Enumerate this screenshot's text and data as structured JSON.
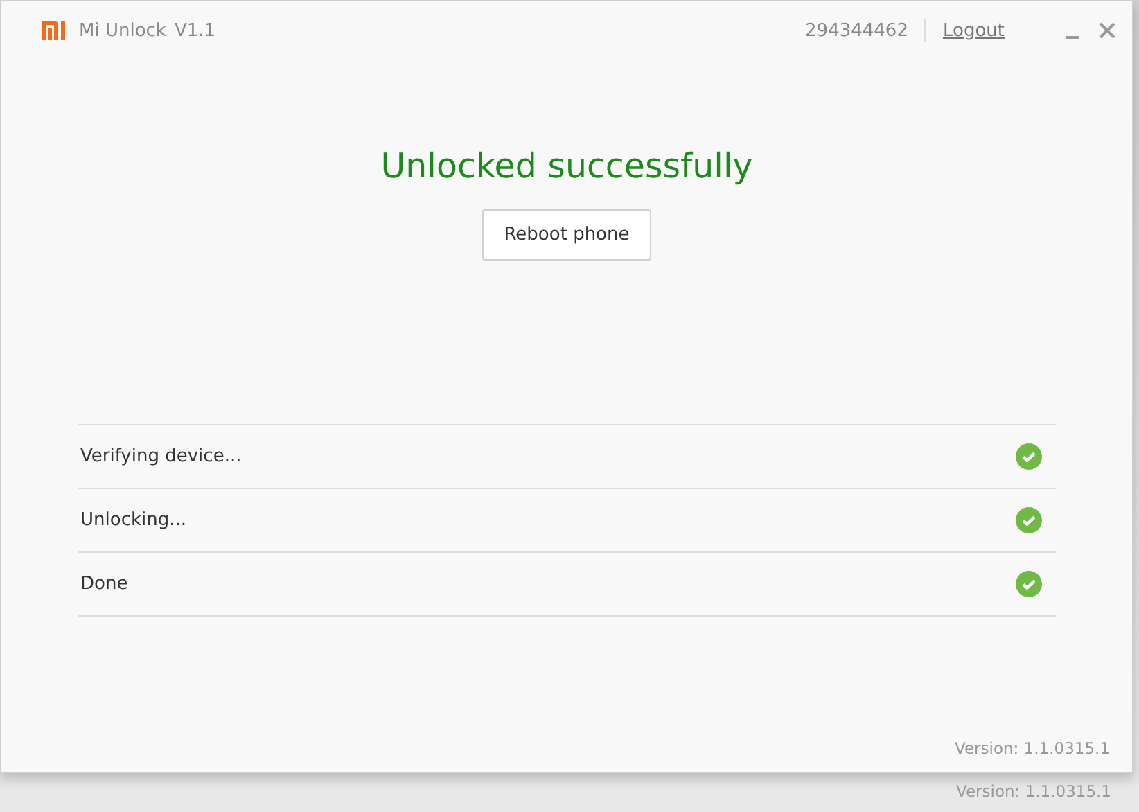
{
  "window": {
    "title": "Mi Unlock",
    "version_label": "V1.1",
    "account": "294344462",
    "logout": "Logout"
  },
  "status": {
    "message": "Unlocked successfully",
    "button": "Reboot phone"
  },
  "steps": [
    {
      "label": "Verifying device...",
      "done": true
    },
    {
      "label": "Unlocking...",
      "done": true
    },
    {
      "label": "Done",
      "done": true
    }
  ],
  "footer": {
    "version": "Version: 1.1.0315.1"
  },
  "background_footer": {
    "version": "Version: 1.1.0315.1"
  }
}
